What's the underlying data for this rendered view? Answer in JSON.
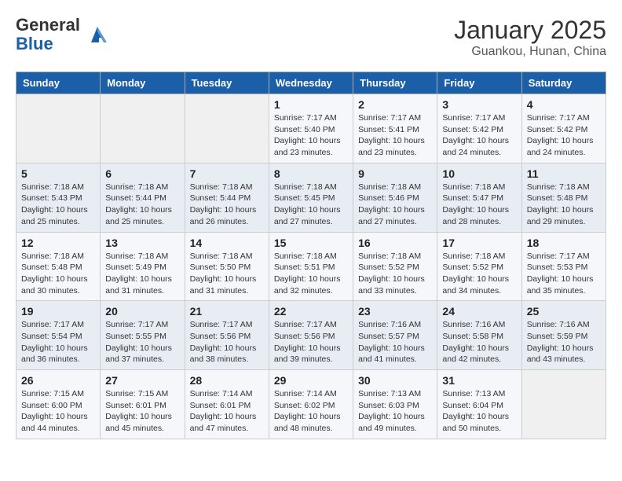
{
  "header": {
    "logo_general": "General",
    "logo_blue": "Blue",
    "title": "January 2025",
    "subtitle": "Guankou, Hunan, China"
  },
  "weekdays": [
    "Sunday",
    "Monday",
    "Tuesday",
    "Wednesday",
    "Thursday",
    "Friday",
    "Saturday"
  ],
  "weeks": [
    [
      {
        "day": "",
        "info": ""
      },
      {
        "day": "",
        "info": ""
      },
      {
        "day": "",
        "info": ""
      },
      {
        "day": "1",
        "info": "Sunrise: 7:17 AM\nSunset: 5:40 PM\nDaylight: 10 hours\nand 23 minutes."
      },
      {
        "day": "2",
        "info": "Sunrise: 7:17 AM\nSunset: 5:41 PM\nDaylight: 10 hours\nand 23 minutes."
      },
      {
        "day": "3",
        "info": "Sunrise: 7:17 AM\nSunset: 5:42 PM\nDaylight: 10 hours\nand 24 minutes."
      },
      {
        "day": "4",
        "info": "Sunrise: 7:17 AM\nSunset: 5:42 PM\nDaylight: 10 hours\nand 24 minutes."
      }
    ],
    [
      {
        "day": "5",
        "info": "Sunrise: 7:18 AM\nSunset: 5:43 PM\nDaylight: 10 hours\nand 25 minutes."
      },
      {
        "day": "6",
        "info": "Sunrise: 7:18 AM\nSunset: 5:44 PM\nDaylight: 10 hours\nand 25 minutes."
      },
      {
        "day": "7",
        "info": "Sunrise: 7:18 AM\nSunset: 5:44 PM\nDaylight: 10 hours\nand 26 minutes."
      },
      {
        "day": "8",
        "info": "Sunrise: 7:18 AM\nSunset: 5:45 PM\nDaylight: 10 hours\nand 27 minutes."
      },
      {
        "day": "9",
        "info": "Sunrise: 7:18 AM\nSunset: 5:46 PM\nDaylight: 10 hours\nand 27 minutes."
      },
      {
        "day": "10",
        "info": "Sunrise: 7:18 AM\nSunset: 5:47 PM\nDaylight: 10 hours\nand 28 minutes."
      },
      {
        "day": "11",
        "info": "Sunrise: 7:18 AM\nSunset: 5:48 PM\nDaylight: 10 hours\nand 29 minutes."
      }
    ],
    [
      {
        "day": "12",
        "info": "Sunrise: 7:18 AM\nSunset: 5:48 PM\nDaylight: 10 hours\nand 30 minutes."
      },
      {
        "day": "13",
        "info": "Sunrise: 7:18 AM\nSunset: 5:49 PM\nDaylight: 10 hours\nand 31 minutes."
      },
      {
        "day": "14",
        "info": "Sunrise: 7:18 AM\nSunset: 5:50 PM\nDaylight: 10 hours\nand 31 minutes."
      },
      {
        "day": "15",
        "info": "Sunrise: 7:18 AM\nSunset: 5:51 PM\nDaylight: 10 hours\nand 32 minutes."
      },
      {
        "day": "16",
        "info": "Sunrise: 7:18 AM\nSunset: 5:52 PM\nDaylight: 10 hours\nand 33 minutes."
      },
      {
        "day": "17",
        "info": "Sunrise: 7:18 AM\nSunset: 5:52 PM\nDaylight: 10 hours\nand 34 minutes."
      },
      {
        "day": "18",
        "info": "Sunrise: 7:17 AM\nSunset: 5:53 PM\nDaylight: 10 hours\nand 35 minutes."
      }
    ],
    [
      {
        "day": "19",
        "info": "Sunrise: 7:17 AM\nSunset: 5:54 PM\nDaylight: 10 hours\nand 36 minutes."
      },
      {
        "day": "20",
        "info": "Sunrise: 7:17 AM\nSunset: 5:55 PM\nDaylight: 10 hours\nand 37 minutes."
      },
      {
        "day": "21",
        "info": "Sunrise: 7:17 AM\nSunset: 5:56 PM\nDaylight: 10 hours\nand 38 minutes."
      },
      {
        "day": "22",
        "info": "Sunrise: 7:17 AM\nSunset: 5:56 PM\nDaylight: 10 hours\nand 39 minutes."
      },
      {
        "day": "23",
        "info": "Sunrise: 7:16 AM\nSunset: 5:57 PM\nDaylight: 10 hours\nand 41 minutes."
      },
      {
        "day": "24",
        "info": "Sunrise: 7:16 AM\nSunset: 5:58 PM\nDaylight: 10 hours\nand 42 minutes."
      },
      {
        "day": "25",
        "info": "Sunrise: 7:16 AM\nSunset: 5:59 PM\nDaylight: 10 hours\nand 43 minutes."
      }
    ],
    [
      {
        "day": "26",
        "info": "Sunrise: 7:15 AM\nSunset: 6:00 PM\nDaylight: 10 hours\nand 44 minutes."
      },
      {
        "day": "27",
        "info": "Sunrise: 7:15 AM\nSunset: 6:01 PM\nDaylight: 10 hours\nand 45 minutes."
      },
      {
        "day": "28",
        "info": "Sunrise: 7:14 AM\nSunset: 6:01 PM\nDaylight: 10 hours\nand 47 minutes."
      },
      {
        "day": "29",
        "info": "Sunrise: 7:14 AM\nSunset: 6:02 PM\nDaylight: 10 hours\nand 48 minutes."
      },
      {
        "day": "30",
        "info": "Sunrise: 7:13 AM\nSunset: 6:03 PM\nDaylight: 10 hours\nand 49 minutes."
      },
      {
        "day": "31",
        "info": "Sunrise: 7:13 AM\nSunset: 6:04 PM\nDaylight: 10 hours\nand 50 minutes."
      },
      {
        "day": "",
        "info": ""
      }
    ]
  ]
}
